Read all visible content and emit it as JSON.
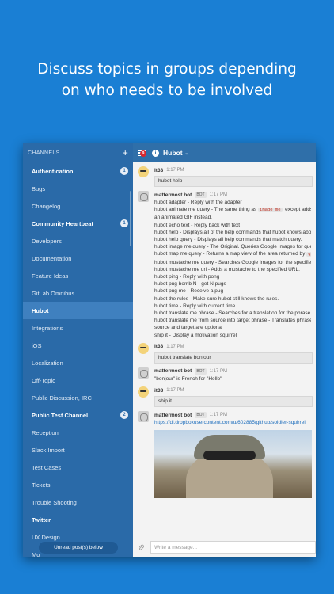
{
  "headline": {
    "line1": "Discuss topics in groups depending",
    "line2": "on who needs to be involved"
  },
  "sidebar": {
    "header": "CHANNELS",
    "add_symbol": "+",
    "channels": [
      {
        "label": "Authentication",
        "bold": true,
        "badge": "1"
      },
      {
        "label": "Bugs"
      },
      {
        "label": "Changelog"
      },
      {
        "label": "Community Heartbeat",
        "bold": true,
        "badge": "1"
      },
      {
        "label": "Developers"
      },
      {
        "label": "Documentation"
      },
      {
        "label": "Feature Ideas"
      },
      {
        "label": "GitLab Omnibus"
      },
      {
        "label": "Hubot",
        "active": true
      },
      {
        "label": "Integrations"
      },
      {
        "label": "iOS"
      },
      {
        "label": "Localization"
      },
      {
        "label": "Off-Topic"
      },
      {
        "label": "Public Discussion, IRC"
      },
      {
        "label": "Public Test Channel",
        "bold": true,
        "badge": "2"
      },
      {
        "label": "Reception"
      },
      {
        "label": "Slack Import"
      },
      {
        "label": "Test Cases"
      },
      {
        "label": "Tickets"
      },
      {
        "label": "Trouble Shooting"
      },
      {
        "label": "Twitter",
        "bold": true
      },
      {
        "label": "UX Design"
      },
      {
        "label": "Mo"
      }
    ],
    "unread_pill": "Unread post(s) below"
  },
  "topbar": {
    "notification_count": "9",
    "channel_name": "Hubot",
    "chevron": "⌄"
  },
  "posts": [
    {
      "user": "it33",
      "avatar": "it33",
      "time": "1:17 PM",
      "bubble": "hubot help"
    },
    {
      "user": "mattermost bot",
      "avatar": "bot",
      "bot_tag": "BOT",
      "time": "1:17 PM",
      "lines": [
        "hubot adapter - Reply with the adapter",
        "hubot animate me query - The same thing as |image me|, except adds a f",
        "an animated GIF instead.",
        "hubot echo text - Reply back with text",
        "hubot help - Displays all of the help commands that hubot knows about.",
        "hubot help query - Displays all help commands that match query.",
        "hubot image me query - The Original. Queries Google Images for query",
        "hubot map me query - Returns a map view of the area returned by |que",
        "hubot mustache me query - Searches Google Images for the specified q",
        "hubot mustache me url - Adds a mustache to the specified URL.",
        "hubot ping - Reply with pong",
        "hubot pug bomb N - get N pugs",
        "hubot pug me - Receive a pug",
        "hubot the rules - Make sure hubot still knows the rules.",
        "hubot time - Reply with current time",
        "hubot translate me phrase - Searches for a translation for the phrase an",
        "hubot translate me from source into target phrase - Translates phrase f",
        "source and target are optional",
        "ship it - Display a motivation squirrel"
      ]
    },
    {
      "user": "it33",
      "avatar": "it33",
      "time": "1:17 PM",
      "bubble": "hubot translate bonjour"
    },
    {
      "user": "mattermost bot",
      "avatar": "bot",
      "bot_tag": "BOT",
      "time": "1:17 PM",
      "lines": [
        "\"bonjour\" is French for \"Hello\""
      ]
    },
    {
      "user": "it33",
      "avatar": "it33",
      "time": "1:17 PM",
      "bubble": "ship it"
    },
    {
      "user": "mattermost bot",
      "avatar": "bot",
      "bot_tag": "BOT",
      "time": "1:17 PM",
      "link": "https://dl.dropboxusercontent.com/u/602885/github/soldier-squirrel.",
      "has_image": true
    }
  ],
  "composer": {
    "placeholder": "Write a message..."
  },
  "colors": {
    "background": "#1a7fd4",
    "sidebar": "#2a6aa8",
    "sidebar_active": "#3f80bf",
    "topbar": "#2f6fa9",
    "badge_red": "#d9272e"
  }
}
